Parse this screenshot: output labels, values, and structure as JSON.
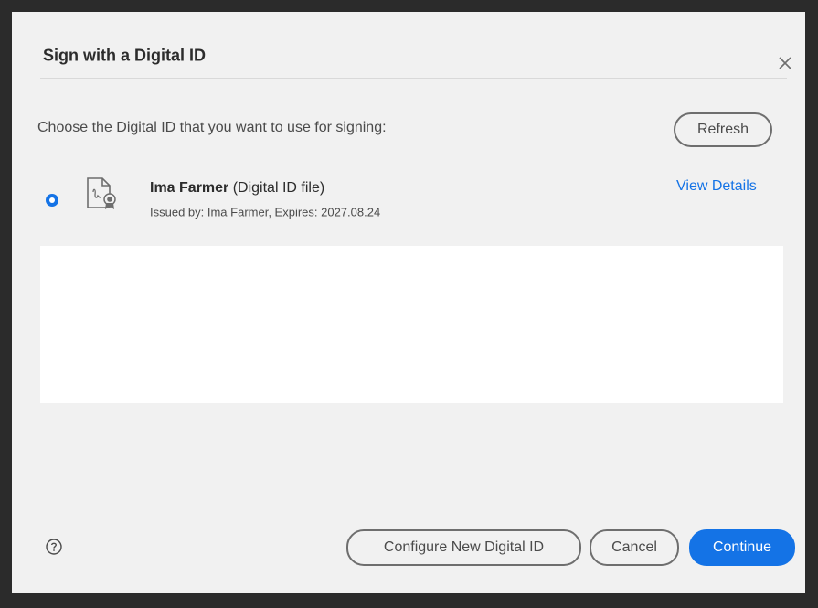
{
  "dialog": {
    "title": "Sign with a Digital ID",
    "prompt": "Choose the Digital ID that you want to use for signing:",
    "refresh_label": "Refresh"
  },
  "digital_id": {
    "name": "Ima Farmer",
    "type": "(Digital ID file)",
    "issued": "Issued by: Ima Farmer, Expires: 2027.08.24",
    "selected": true,
    "view_details_label": "View Details"
  },
  "footer": {
    "configure_label": "Configure New Digital ID",
    "cancel_label": "Cancel",
    "continue_label": "Continue"
  },
  "icons": {
    "close": "close-icon",
    "certificate": "certificate-icon",
    "help": "help-icon"
  },
  "colors": {
    "accent": "#1473e6",
    "dialog_bg": "#f1f1f1",
    "backdrop": "#2b2b2b"
  }
}
